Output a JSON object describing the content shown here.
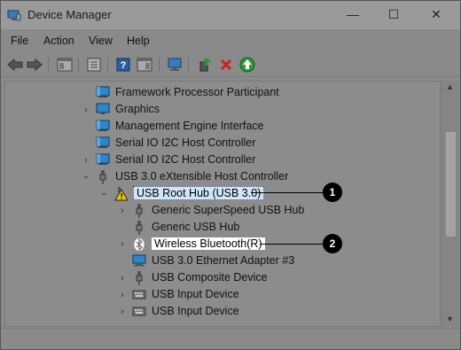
{
  "window": {
    "title": "Device Manager",
    "controls": {
      "minimize": "—",
      "maximize": "☐",
      "close": "✕"
    }
  },
  "menu": [
    "File",
    "Action",
    "View",
    "Help"
  ],
  "toolbar": {
    "buttons": [
      "back-arrow-icon",
      "forward-arrow-icon",
      "show-hide-tree-icon",
      "properties-icon",
      "help-icon",
      "action-pane-icon",
      "scan-hardware-icon",
      "update-driver-icon",
      "uninstall-device-icon",
      "enable-device-icon"
    ],
    "colors": {
      "uninstall": "#d11f1f",
      "enable": "#2a9a38",
      "update_green": "#2a9a38"
    }
  },
  "tree": {
    "items": [
      {
        "label": "Framework Processor Participant",
        "icon": "system-device-icon"
      },
      {
        "label": "Graphics",
        "icon": "display-adapter-icon"
      },
      {
        "label": "Management Engine Interface",
        "icon": "system-device-icon"
      },
      {
        "label": "Serial IO I2C Host Controller",
        "icon": "system-device-icon"
      },
      {
        "label": "Serial IO I2C Host Controller",
        "icon": "system-device-icon"
      },
      {
        "label": "USB 3.0 eXtensible Host Controller",
        "icon": "usb-controller-icon"
      },
      {
        "label": "USB Root Hub (USB 3.0)",
        "icon": "usb-warning-icon"
      },
      {
        "label": "Generic SuperSpeed USB Hub",
        "icon": "usb-plug-icon"
      },
      {
        "label": "Generic USB Hub",
        "icon": "usb-plug-icon"
      },
      {
        "label": "Wireless Bluetooth(R)",
        "icon": "bluetooth-icon"
      },
      {
        "label": "USB 3.0 Ethernet Adapter #3",
        "icon": "network-adapter-icon"
      },
      {
        "label": "USB Composite Device",
        "icon": "usb-plug-icon"
      },
      {
        "label": "USB Input Device",
        "icon": "keyboard-icon"
      },
      {
        "label": "USB Input Device",
        "icon": "keyboard-icon"
      }
    ]
  },
  "callouts": [
    "1",
    "2"
  ]
}
